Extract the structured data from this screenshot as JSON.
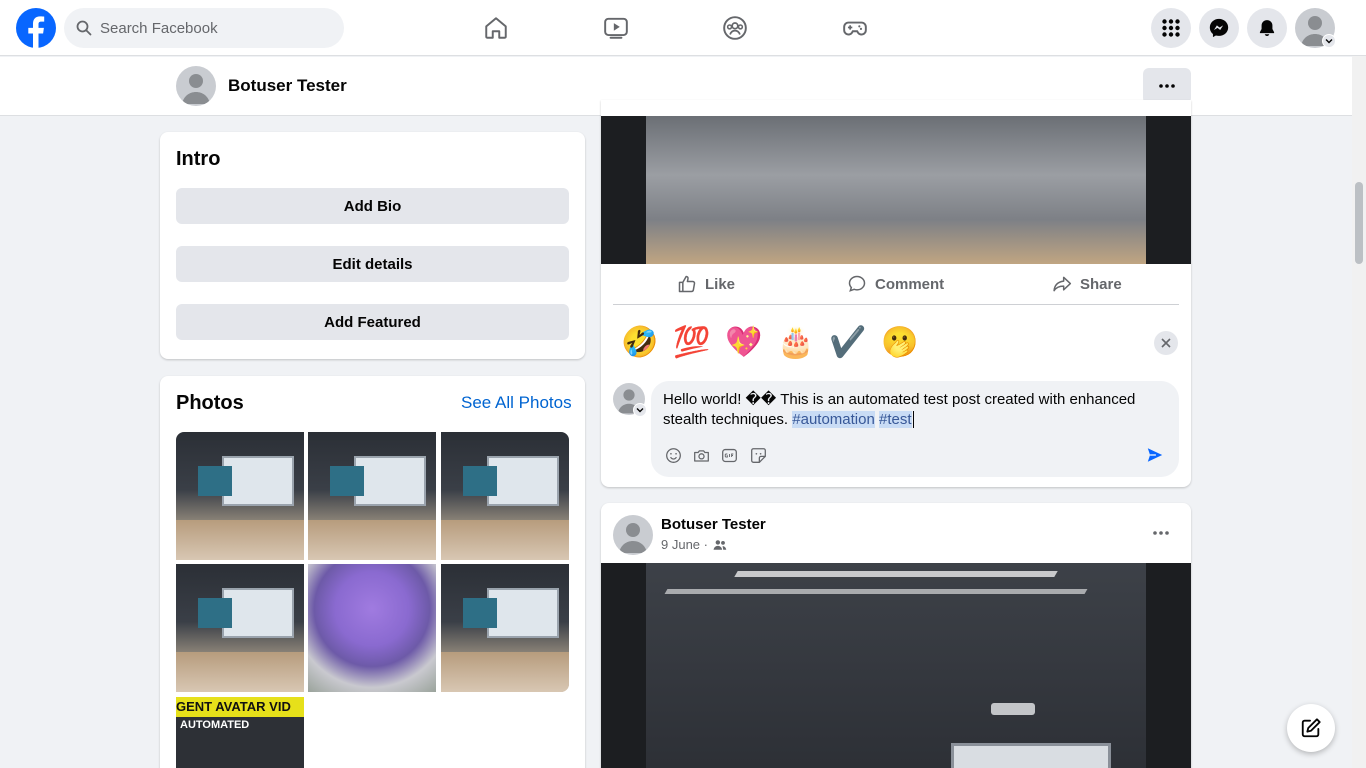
{
  "search": {
    "placeholder": "Search Facebook"
  },
  "profile": {
    "name": "Botuser Tester"
  },
  "intro": {
    "title": "Intro",
    "buttons": [
      "Add Bio",
      "Edit details",
      "Add Featured"
    ]
  },
  "photos": {
    "title": "Photos",
    "see_all": "See All Photos",
    "poster_band": "GENT AVATAR VID",
    "poster_sub": "AUTOMATED"
  },
  "post_actions": {
    "like": "Like",
    "comment": "Comment",
    "share": "Share"
  },
  "reactions": [
    "🤣",
    "💯",
    "💖",
    "🎂",
    "✔️",
    "🫢"
  ],
  "composer": {
    "text": "Hello world! �� This is an automated test post created with enhanced stealth techniques. ",
    "tags": [
      "#automation",
      "#test"
    ]
  },
  "post2": {
    "author": "Botuser Tester",
    "date": "9 June",
    "separator": " · "
  },
  "colors": {
    "brand": "#0866ff",
    "link": "#0064d1",
    "bg": "#f0f2f5"
  }
}
